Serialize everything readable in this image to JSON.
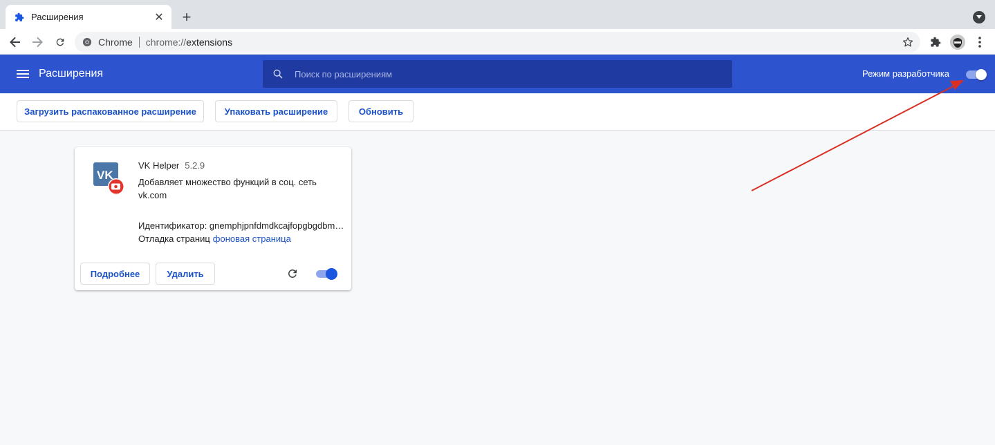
{
  "browser": {
    "tab_title": "Расширения",
    "omnibox": {
      "site_label": "Chrome",
      "url_scheme": "chrome://",
      "url_host": "extensions"
    }
  },
  "header": {
    "title": "Расширения",
    "search_placeholder": "Поиск по расширениям",
    "dev_mode_label": "Режим разработчика",
    "dev_mode_enabled": true
  },
  "devbar": {
    "load_unpacked": "Загрузить распакованное расширение",
    "pack": "Упаковать расширение",
    "update": "Обновить"
  },
  "extension": {
    "name": "VK Helper",
    "version": "5.2.9",
    "description": "Добавляет множество функций в соц. сеть vk.com",
    "id_text": "Идентификатор: gnemphjpnfdmdkcajfopgbgdbmgfkhpn",
    "debug_label": "Отладка страниц",
    "debug_link": "фоновая страница",
    "details_button": "Подробнее",
    "remove_button": "Удалить",
    "enabled": true,
    "icon_text": "VK"
  },
  "colors": {
    "header_bg": "#2e53cf",
    "accent": "#1a53c8",
    "annotation_arrow": "#d93025"
  }
}
